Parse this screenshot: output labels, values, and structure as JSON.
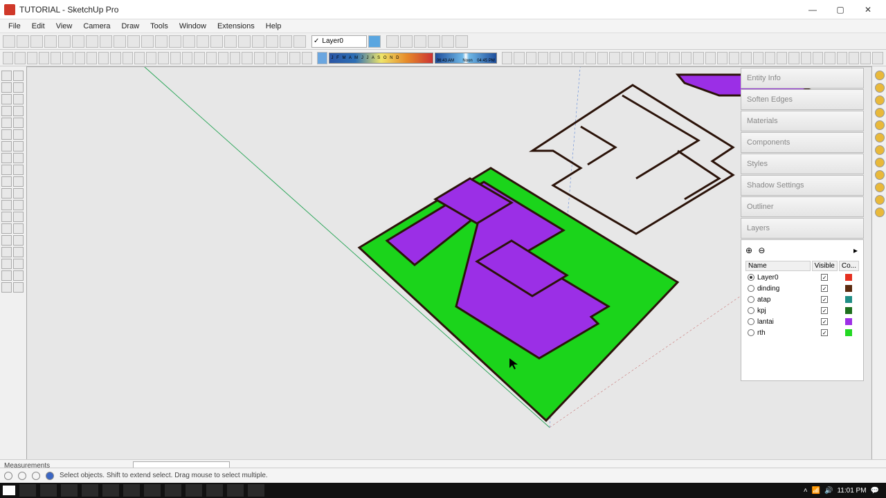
{
  "window": {
    "title": "TUTORIAL - SketchUp Pro",
    "minimize": "—",
    "maximize": "▢",
    "close": "✕"
  },
  "menu": [
    "File",
    "Edit",
    "View",
    "Camera",
    "Draw",
    "Tools",
    "Window",
    "Extensions",
    "Help"
  ],
  "layer_selector": {
    "checked": true,
    "value": "Layer0"
  },
  "shadow_months": "J F M A M J J A S O N D",
  "shadow_time": {
    "start": "06:43 AM",
    "mid": "Noon",
    "end": "04:45 PM"
  },
  "tray": {
    "panels": [
      "Entity Info",
      "Soften Edges",
      "Materials",
      "Components",
      "Styles",
      "Shadow Settings",
      "Outliner",
      "Layers"
    ],
    "layers_header": {
      "name": "Name",
      "visible": "Visible",
      "color": "Co..."
    },
    "rows": [
      {
        "name": "Layer0",
        "active": true,
        "color": "#e53020"
      },
      {
        "name": "dinding",
        "active": false,
        "color": "#5c2b10"
      },
      {
        "name": "atap",
        "active": false,
        "color": "#1f8d85"
      },
      {
        "name": "kpj",
        "active": false,
        "color": "#1d6f1d"
      },
      {
        "name": "lantai",
        "active": false,
        "color": "#9d2fe6"
      },
      {
        "name": "rth",
        "active": false,
        "color": "#23d823"
      }
    ]
  },
  "measurements_label": "Measurements",
  "status_hint": "Select objects. Shift to extend select. Drag mouse to select multiple.",
  "clock": "11:01 PM"
}
